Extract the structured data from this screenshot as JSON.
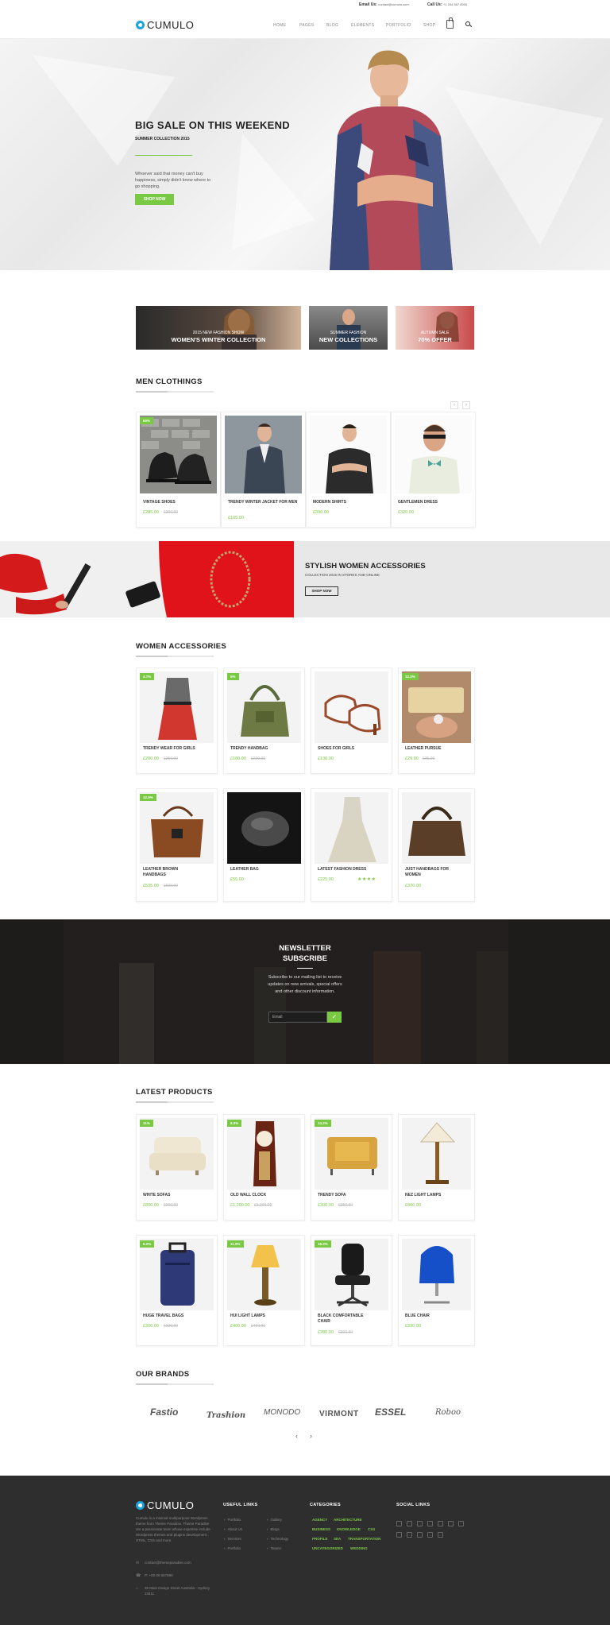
{
  "topbar": {
    "email_label": "Email Us:",
    "email_value": "contact@cumulo.com",
    "call_label": "Call Us:",
    "call_value": "+1 234 567 8900"
  },
  "header": {
    "logo_text": "CUMULO",
    "nav": [
      "HOME",
      "PAGES",
      "BLOG",
      "ELEMENTS",
      "PORTFOLIO",
      "SHOP"
    ]
  },
  "hero": {
    "title": "BIG SALE ON THIS WEEKEND",
    "subtitle": "SUMMER COLLECTION 2015",
    "text": "Whoever said that money can't buy happiness, simply didn't know where to go shopping.",
    "button": "SHOP NOW"
  },
  "promos": [
    {
      "small": "2015 NEW FASHION SHOW",
      "big": "WOMEN'S WINTER COLLECTION"
    },
    {
      "small": "SUMMER FASHION",
      "big": "NEW COLLECTIONS"
    },
    {
      "small": "AUTUMN SALE",
      "big": "70% OFFER"
    }
  ],
  "men": {
    "title": "MEN CLOTHINGS",
    "prev": "‹",
    "next": "›",
    "items": [
      {
        "name": "VINTAGE SHOES",
        "price": "£285.00",
        "old": "£300.00",
        "badge": "50%"
      },
      {
        "name": "TRENDY WINTER JACKET FOR MEN",
        "price": "£165.00",
        "old": "",
        "badge": ""
      },
      {
        "name": "MODERN SHIRTS",
        "price": "£390.00",
        "old": "",
        "badge": ""
      },
      {
        "name": "GENTLEMEN DRESS",
        "price": "£320.00",
        "old": "",
        "badge": ""
      }
    ]
  },
  "band": {
    "title": "STYLISH WOMEN ACCESSORIES",
    "sub": "COLLECTION 2015 IN STORES AND ONLINE",
    "button": "SHOP NOW"
  },
  "women": {
    "title": "WOMEN ACCESSORIES",
    "items": [
      {
        "name": "TRENDY WEAR FOR GIRLS",
        "price": "£200.00",
        "old": "£250.00",
        "badge": "4.7%"
      },
      {
        "name": "TRENDY HANDBAG",
        "price": "£180.00",
        "old": "£220.00",
        "badge": "5%"
      },
      {
        "name": "SHOES FOR GIRLS",
        "price": "£130.00",
        "old": "",
        "badge": ""
      },
      {
        "name": "LEATHER PURSUE",
        "price": "£29.00",
        "old": "£35.00",
        "badge": "12.2%"
      },
      {
        "name": "LEATHER BROWN HANDBAGS",
        "price": "£535.00",
        "old": "£600.00",
        "badge": "12.9%"
      },
      {
        "name": "LEATHER BAG",
        "price": "£55.00",
        "old": "",
        "badge": ""
      },
      {
        "name": "LATEST FASHION DRESS",
        "price": "£225.00",
        "old": "",
        "badge": "",
        "stars": "★★★★"
      },
      {
        "name": "JUST HANDBAGS FOR WOMEN",
        "price": "£370.00",
        "old": "",
        "badge": ""
      }
    ]
  },
  "newsletter": {
    "title_line1": "NEWSLETTER",
    "title_line2": "SUBSCRIBE",
    "text": "Subscribe to our mailing list to receive updates on new arrivals, special offers and other discount information.",
    "placeholder": "Email",
    "button": "✓"
  },
  "latest": {
    "title": "LATEST PRODUCTS",
    "items": [
      {
        "name": "WHITE SOFAS",
        "price": "£800.00",
        "old": "£900.00",
        "badge": "11%"
      },
      {
        "name": "OLD WALL CLOCK",
        "price": "£1,200.00",
        "old": "£1,300.00",
        "badge": "8.3%"
      },
      {
        "name": "TRENDY SOFA",
        "price": "£300.00",
        "old": "£350.00",
        "badge": "14.2%"
      },
      {
        "name": "NEZ LIGHT LAMPS",
        "price": "£400.00",
        "old": "",
        "badge": ""
      },
      {
        "name": "HUGE TRAVEL BAGS",
        "price": "£300.00",
        "old": "£320.00",
        "badge": "6.2%"
      },
      {
        "name": "HUI LIGHT LAMPS",
        "price": "£400.00",
        "old": "£450.00",
        "badge": "11.9%"
      },
      {
        "name": "BLACK COMFORTABLE CHAIR",
        "price": "£280.00",
        "old": "£300.00",
        "badge": "16.3%"
      },
      {
        "name": "BLUE CHAIR",
        "price": "£330.00",
        "old": "",
        "badge": ""
      }
    ]
  },
  "brands": {
    "title": "OUR BRANDS",
    "names": [
      "Fastio",
      "Trashion",
      "MONODO",
      "VIRMONT",
      "ESSEL",
      "Roboo"
    ],
    "prev": "‹",
    "next": "›"
  },
  "footer": {
    "logo_text": "CUMULO",
    "about": "Cumulo is a minimal multipurpose Wordpress theme from Theme Paradise. Theme Paradise are a passionate team whose expertise include Wordpress themes and plugins development, HTML, CSS and more.",
    "email": "contact@themeparadise.com",
    "phone": "P: +00 00 567890",
    "address": "35 Main Design Street Australia - Sydney 23411",
    "useful_title": "USEFUL LINKS",
    "useful_col1": [
      "Portfolio",
      "About Us",
      "Services",
      "Portfolio"
    ],
    "useful_col2": [
      "Gallery",
      "Blogs",
      "Technology",
      "Teams"
    ],
    "categories_title": "CATEGORIES",
    "categories": [
      "AGENCY",
      "ARCHITECTURE",
      "BUSINESS",
      "KNOWLEDGE",
      "CSS",
      "PROFILE",
      "SEA",
      "TRANSPORTATION",
      "UNCATEGORIZED",
      "WEDDING"
    ],
    "social_title": "SOCIAL LINKS"
  }
}
